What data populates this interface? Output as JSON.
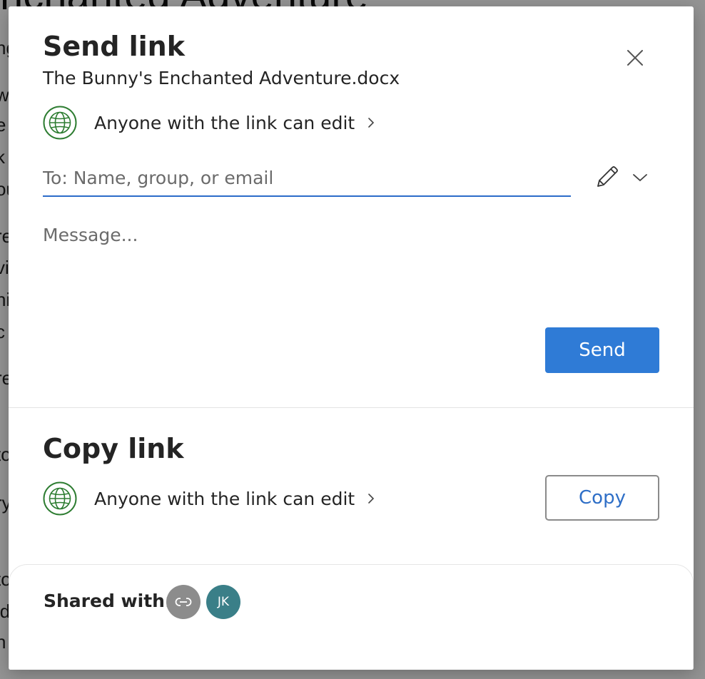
{
  "background": {
    "title": "nchanted Adventure",
    "lines": [
      "ng",
      "w",
      "e",
      "k",
      "ou",
      "re",
      "vi",
      "ni",
      "c",
      "re",
      "to",
      "ry",
      "to",
      "ld",
      "h"
    ]
  },
  "send_section": {
    "title": "Send link",
    "file_name": "The Bunny's Enchanted Adventure.docx",
    "permission_text": "Anyone with the link can edit",
    "to_placeholder": "To: Name, group, or email",
    "message_placeholder": "Message...",
    "send_label": "Send"
  },
  "copy_section": {
    "title": "Copy link",
    "permission_text": "Anyone with the link can edit",
    "copy_label": "Copy"
  },
  "shared": {
    "label": "Shared with:",
    "avatars": [
      {
        "type": "link",
        "icon": "link-icon",
        "color": "#8c8c8c"
      },
      {
        "type": "user",
        "initials": "JK",
        "color": "#3a7f88"
      }
    ]
  },
  "colors": {
    "accent": "#2f7bd6",
    "globe": "#2e7d32",
    "input_underline": "#2b6cc9"
  }
}
